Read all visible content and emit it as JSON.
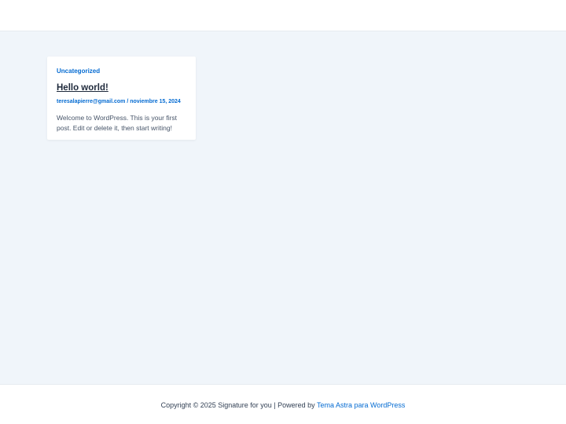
{
  "post": {
    "category": "Uncategorized",
    "title": "Hello world!",
    "author": "teresalapierre@gmail.com",
    "meta_separator": " / ",
    "date": "noviembre 15, 2024",
    "excerpt": "Welcome to WordPress. This is your first post. Edit or delete it, then start writing!"
  },
  "footer": {
    "copyright": "Copyright © 2025 Signature for you | Powered by ",
    "theme_link": "Tema Astra para WordPress"
  },
  "colors": {
    "accent": "#046bd2",
    "page_background": "#f0f5fa",
    "card_background": "#ffffff"
  }
}
